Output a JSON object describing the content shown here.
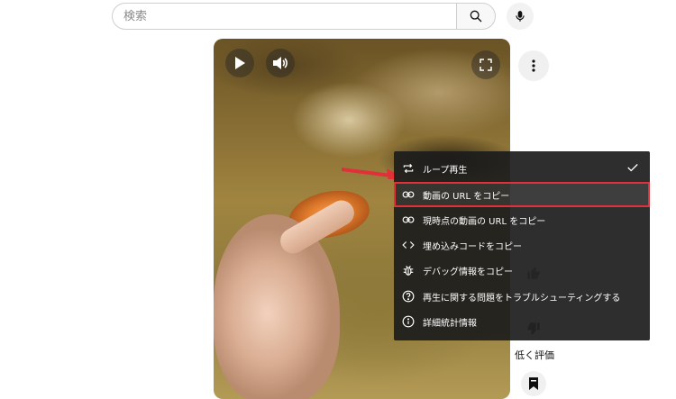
{
  "search": {
    "placeholder": "検索"
  },
  "menu": {
    "items": [
      {
        "label": "ループ再生",
        "icon": "loop-icon",
        "checked": true
      },
      {
        "label": "動画の URL をコピー",
        "icon": "link-icon",
        "highlighted": true
      },
      {
        "label": "現時点の動画の URL をコピー",
        "icon": "link-icon"
      },
      {
        "label": "埋め込みコードをコピー",
        "icon": "code-icon"
      },
      {
        "label": "デバッグ情報をコピー",
        "icon": "bug-icon"
      },
      {
        "label": "再生に関する問題をトラブルシューティングする",
        "icon": "help-icon"
      },
      {
        "label": "詳細統計情報",
        "icon": "info-icon"
      }
    ]
  },
  "sidebar": {
    "dislike_label": "低く評価"
  },
  "colors": {
    "highlight": "#e0303a",
    "menu_bg": "#1c1c1c"
  }
}
